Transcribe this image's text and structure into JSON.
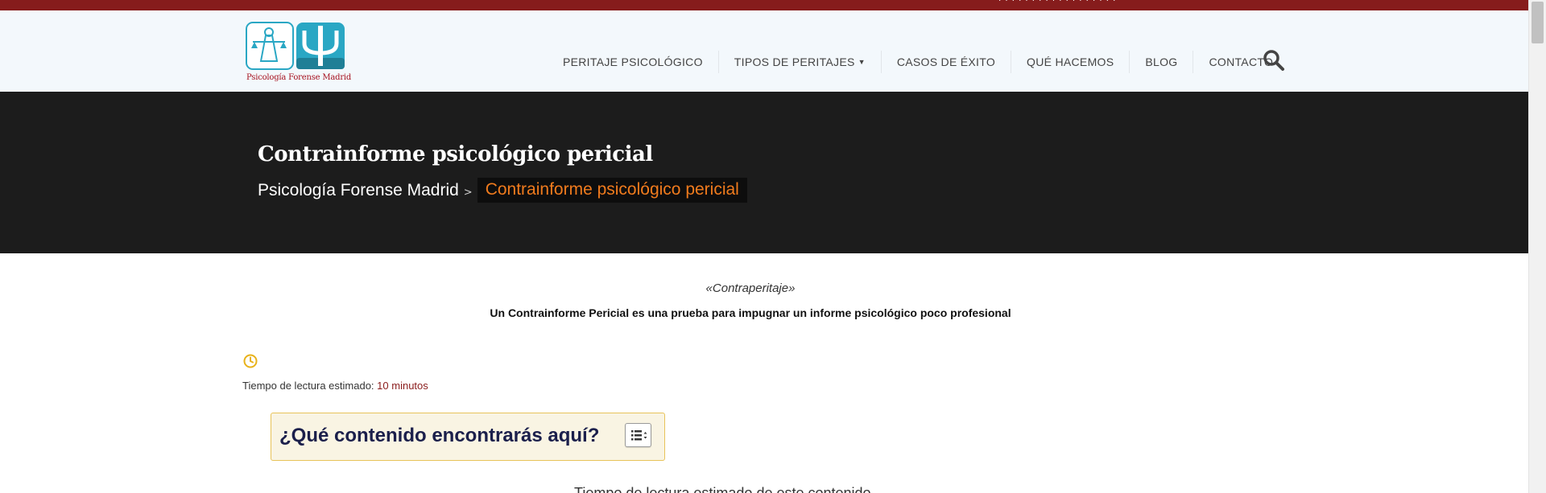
{
  "topbar": {
    "text": "· · ·   · · · · · · ·   · · · · · · · ·"
  },
  "header": {
    "logo_text": "Psicología Forense Madrid",
    "nav": [
      {
        "label": "PERITAJE PSICOLÓGICO"
      },
      {
        "label": "TIPOS DE PERITAJES",
        "has_dropdown": true
      },
      {
        "label": "CASOS DE ÉXITO"
      },
      {
        "label": "QUÉ HACEMOS"
      },
      {
        "label": "BLOG"
      },
      {
        "label": "CONTACTO"
      }
    ],
    "search_icon": "search-icon"
  },
  "hero": {
    "title": "Contrainforme psicológico pericial",
    "breadcrumb": {
      "home": "Psicología Forense Madrid",
      "separator": ">",
      "current": "Contrainforme psicológico pericial"
    }
  },
  "content": {
    "subtitle": "«Contraperitaje»",
    "lead": "Un Contrainforme Pericial es una prueba para impugnar un informe psicológico poco profesional",
    "reading_time_label": "Tiempo de lectura estimado:",
    "reading_time_value": "10 minutos",
    "toc_title": "¿Qué contenido encontrarás aquí?",
    "caption_peek": "Tiempo de lectura estimado de este contenido"
  },
  "colors": {
    "topbar": "#861c1c",
    "header_bg": "#f3f8fc",
    "hero_bg": "#1c1c1c",
    "breadcrumb_current": "#f07b1d",
    "toc_border": "#e8c35a",
    "toc_bg": "#f9f4e3",
    "clock": "#e8b21a",
    "logo_teal": "#2aa7c4"
  }
}
